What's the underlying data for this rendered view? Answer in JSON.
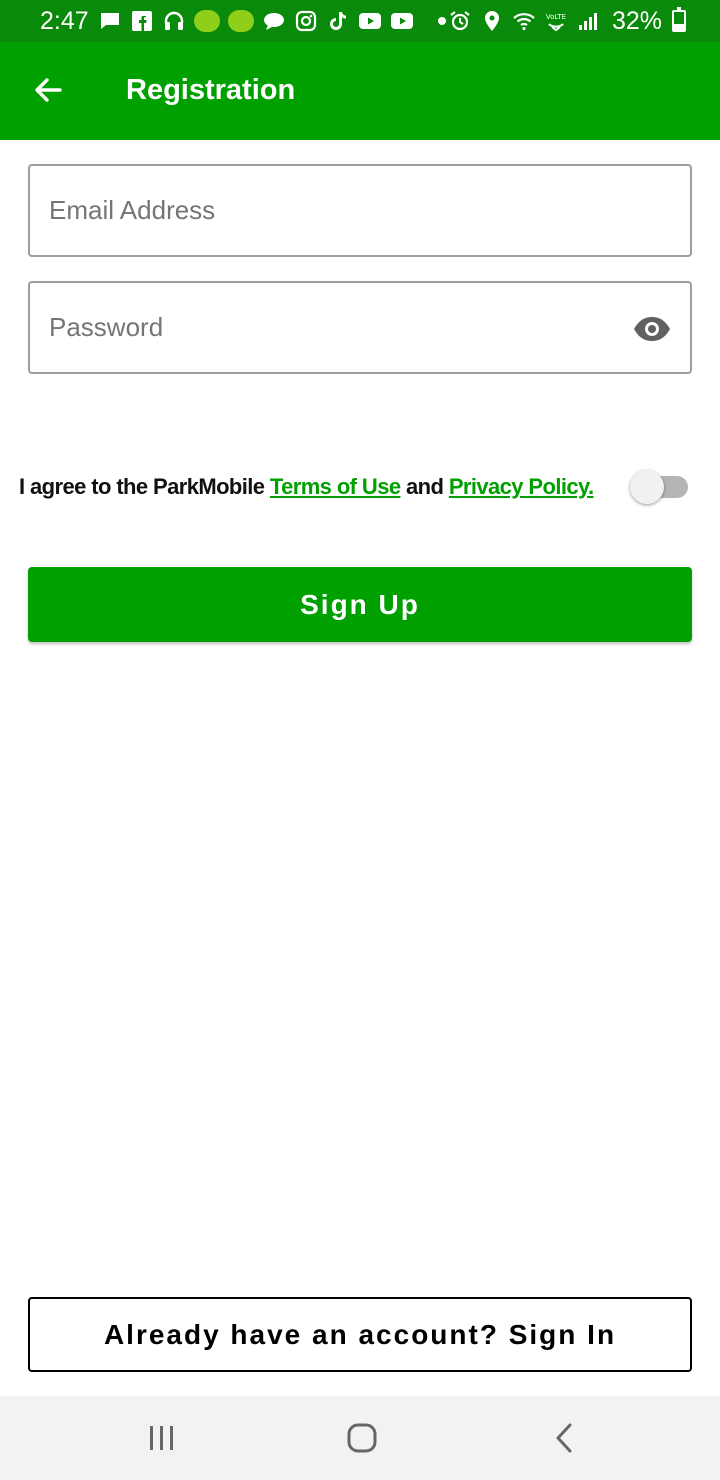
{
  "status_bar": {
    "time": "2:47",
    "battery_text": "32%",
    "battery_level": 0.32,
    "left_icons": [
      "message-icon",
      "facebook-icon",
      "headphones-icon",
      "app-badge-icon",
      "app-badge-icon",
      "chat-bubble-icon",
      "instagram-icon",
      "tiktok-icon",
      "youtube-icon",
      "youtube-icon",
      "dot-icon"
    ],
    "right_icons": [
      "alarm-icon",
      "location-icon",
      "wifi-icon",
      "volte-icon",
      "signal-icon"
    ]
  },
  "app_bar": {
    "title": "Registration",
    "background": "#00a000"
  },
  "form": {
    "email_placeholder": "Email Address",
    "email_value": "",
    "password_placeholder": "Password",
    "password_value": ""
  },
  "agreement": {
    "prefix": "I agree to the ParkMobile ",
    "terms_link": "Terms of Use",
    "middle": " and ",
    "privacy_link": "Privacy Policy.",
    "toggle_on": false
  },
  "buttons": {
    "sign_up": "Sign Up",
    "sign_in": "Already have an account? Sign In"
  },
  "colors": {
    "accent": "#00a000",
    "status_bar": "#0a8a0a",
    "text": "#111111"
  }
}
